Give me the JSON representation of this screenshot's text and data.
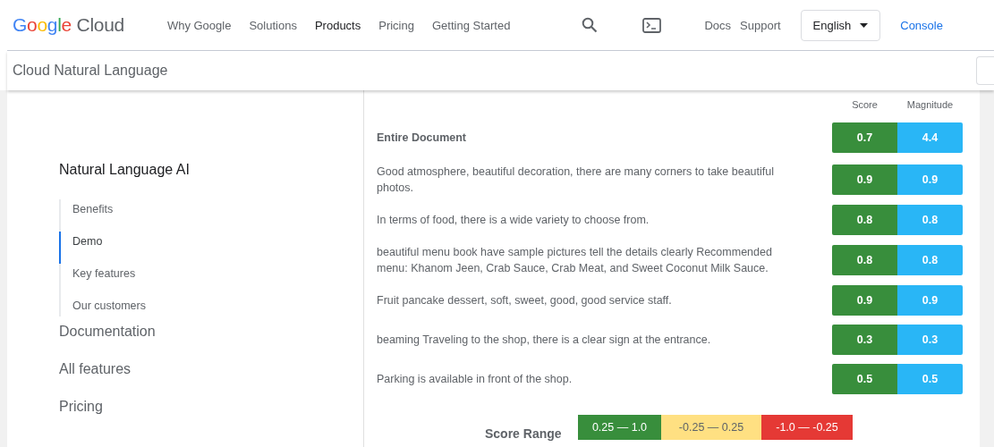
{
  "header": {
    "logo": {
      "word": "Google",
      "product": "Cloud"
    },
    "nav": [
      {
        "label": "Why Google",
        "selected": false
      },
      {
        "label": "Solutions",
        "selected": false
      },
      {
        "label": "Products",
        "selected": true
      },
      {
        "label": "Pricing",
        "selected": false
      },
      {
        "label": "Getting Started",
        "selected": false
      }
    ],
    "links": [
      "Docs",
      "Support"
    ],
    "language": "English",
    "console": "Console"
  },
  "subheader": {
    "title": "Cloud Natural Language"
  },
  "sidebar": {
    "heading": "Natural Language AI",
    "items": [
      {
        "label": "Benefits",
        "selected": false
      },
      {
        "label": "Demo",
        "selected": true
      },
      {
        "label": "Key features",
        "selected": false
      },
      {
        "label": "Our customers",
        "selected": false
      }
    ],
    "sections": [
      "Documentation",
      "All features",
      "Pricing"
    ]
  },
  "results": {
    "columns": [
      "Score",
      "Magnitude"
    ],
    "rows": [
      {
        "kind": "document",
        "text": "Entire Document",
        "score": "0.7",
        "magnitude": "4.4"
      },
      {
        "kind": "sentence",
        "text": "Good atmosphere, beautiful decoration, there are many corners to take beautiful photos.",
        "score": "0.9",
        "magnitude": "0.9"
      },
      {
        "kind": "sentence",
        "text": "In terms of food, there is a wide variety to choose from.",
        "score": "0.8",
        "magnitude": "0.8"
      },
      {
        "kind": "sentence",
        "text": "beautiful menu book have sample pictures tell the details clearly Recommended menu: Khanom Jeen, Crab Sauce, Crab Meat, and Sweet Coconut Milk Sauce.",
        "score": "0.8",
        "magnitude": "0.8"
      },
      {
        "kind": "sentence",
        "text": "Fruit pancake dessert, soft, sweet, good, good service staff.",
        "score": "0.9",
        "magnitude": "0.9"
      },
      {
        "kind": "sentence",
        "text": "beaming Traveling to the shop, there is a clear sign at the entrance.",
        "score": "0.3",
        "magnitude": "0.3"
      },
      {
        "kind": "sentence",
        "text": "Parking is available in front of the shop.",
        "score": "0.5",
        "magnitude": "0.5"
      }
    ],
    "legend": {
      "label": "Score Range",
      "ranges": [
        {
          "text": "0.25 — 1.0",
          "color": "#388e3c"
        },
        {
          "text": "-0.25 — 0.25",
          "color": "#ffe082"
        },
        {
          "text": "-1.0 — -0.25",
          "color": "#e53935"
        }
      ]
    }
  }
}
